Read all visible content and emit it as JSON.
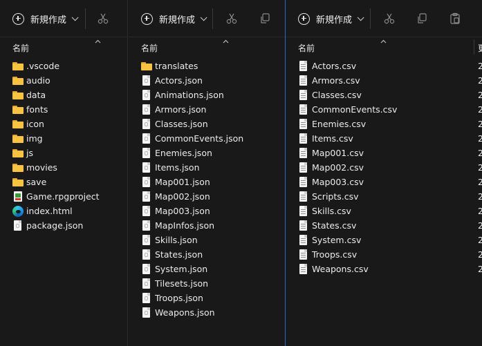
{
  "toolbar": {
    "new_label": "新規作成"
  },
  "header": {
    "name_label": "名前",
    "next_col_label": "更"
  },
  "pane_a": {
    "items": [
      {
        "label": ".vscode",
        "type": "folder"
      },
      {
        "label": "audio",
        "type": "folder"
      },
      {
        "label": "data",
        "type": "folder"
      },
      {
        "label": "fonts",
        "type": "folder"
      },
      {
        "label": "icon",
        "type": "folder"
      },
      {
        "label": "img",
        "type": "folder"
      },
      {
        "label": "js",
        "type": "folder"
      },
      {
        "label": "movies",
        "type": "folder"
      },
      {
        "label": "save",
        "type": "folder"
      },
      {
        "label": "Game.rpgproject",
        "type": "rpgproject"
      },
      {
        "label": "index.html",
        "type": "edge"
      },
      {
        "label": "package.json",
        "type": "json"
      }
    ]
  },
  "pane_b": {
    "items": [
      {
        "label": "translates",
        "type": "folder"
      },
      {
        "label": "Actors.json",
        "type": "json"
      },
      {
        "label": "Animations.json",
        "type": "json"
      },
      {
        "label": "Armors.json",
        "type": "json"
      },
      {
        "label": "Classes.json",
        "type": "json"
      },
      {
        "label": "CommonEvents.json",
        "type": "json"
      },
      {
        "label": "Enemies.json",
        "type": "json"
      },
      {
        "label": "Items.json",
        "type": "json"
      },
      {
        "label": "Map001.json",
        "type": "json"
      },
      {
        "label": "Map002.json",
        "type": "json"
      },
      {
        "label": "Map003.json",
        "type": "json"
      },
      {
        "label": "MapInfos.json",
        "type": "json"
      },
      {
        "label": "Skills.json",
        "type": "json"
      },
      {
        "label": "States.json",
        "type": "json"
      },
      {
        "label": "System.json",
        "type": "json"
      },
      {
        "label": "Tilesets.json",
        "type": "json"
      },
      {
        "label": "Troops.json",
        "type": "json"
      },
      {
        "label": "Weapons.json",
        "type": "json"
      }
    ]
  },
  "pane_c": {
    "trail": "2",
    "items": [
      {
        "label": "Actors.csv",
        "type": "csv"
      },
      {
        "label": "Armors.csv",
        "type": "csv"
      },
      {
        "label": "Classes.csv",
        "type": "csv"
      },
      {
        "label": "CommonEvents.csv",
        "type": "csv"
      },
      {
        "label": "Enemies.csv",
        "type": "csv"
      },
      {
        "label": "Items.csv",
        "type": "csv"
      },
      {
        "label": "Map001.csv",
        "type": "csv"
      },
      {
        "label": "Map002.csv",
        "type": "csv"
      },
      {
        "label": "Map003.csv",
        "type": "csv"
      },
      {
        "label": "Scripts.csv",
        "type": "csv"
      },
      {
        "label": "Skills.csv",
        "type": "csv"
      },
      {
        "label": "States.csv",
        "type": "csv"
      },
      {
        "label": "System.csv",
        "type": "csv"
      },
      {
        "label": "Troops.csv",
        "type": "csv"
      },
      {
        "label": "Weapons.csv",
        "type": "csv"
      }
    ]
  },
  "colors": {
    "background": "#191919",
    "accent_divider": "#1f6fc4",
    "folder": "#f7c340"
  },
  "icons": [
    "plus-circle-icon",
    "chevron-down-icon",
    "cut-icon",
    "copy-icon",
    "paste-icon",
    "sort-up-icon",
    "folder-icon",
    "json-file-icon",
    "csv-file-icon",
    "rpgproject-icon",
    "edge-icon"
  ]
}
